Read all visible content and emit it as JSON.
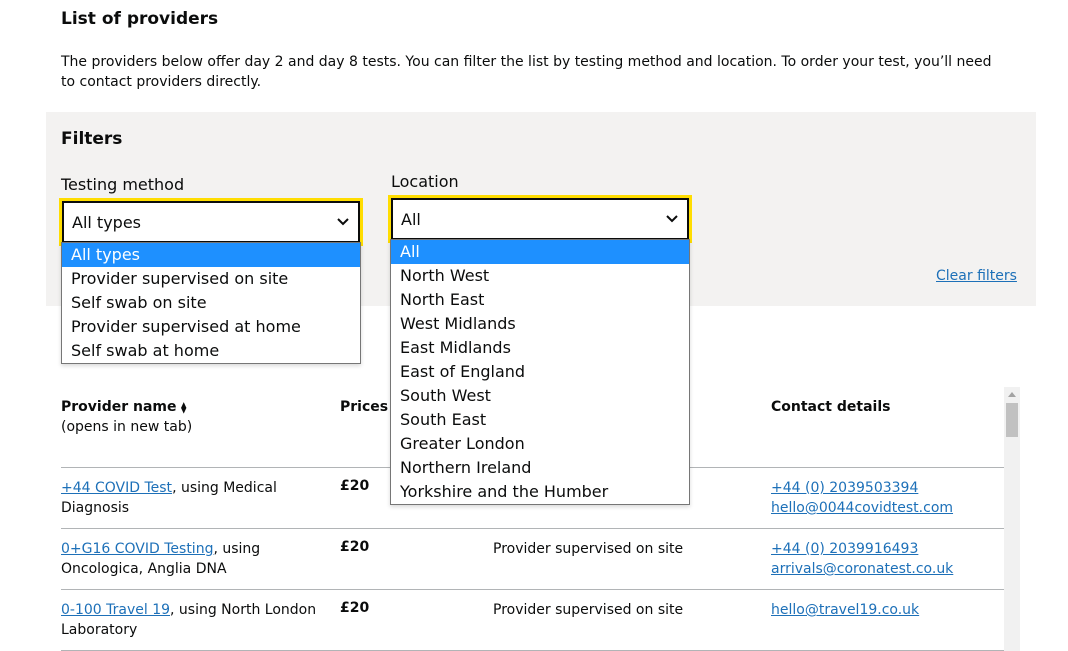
{
  "page": {
    "title": "List of providers",
    "intro": "The providers below offer day 2 and day 8 tests. You can filter the list by testing method and location. To order your test, you’ll need to contact providers directly."
  },
  "filters": {
    "title": "Filters",
    "testing_method": {
      "label": "Testing method",
      "selected": "All types",
      "options": [
        "All types",
        "Provider supervised on site",
        "Self swab on site",
        "Provider supervised at home",
        "Self swab at home"
      ]
    },
    "location": {
      "label": "Location",
      "selected": "All",
      "options": [
        "All",
        "North West",
        "North East",
        "West Midlands",
        "East Midlands",
        "East of England",
        "South West",
        "South East",
        "Greater London",
        "Northern Ireland",
        "Yorkshire and the Humber"
      ]
    },
    "clear_label": "Clear filters"
  },
  "table": {
    "headers": {
      "provider": "Provider name",
      "provider_sort_glyph": "⧫",
      "provider_note": "(opens in new tab)",
      "prices": "Prices",
      "contact": "Contact details"
    },
    "rows": [
      {
        "name": "+44 COVID Test",
        "lab_prefix": ", using Medical",
        "lab_rest": "Diagnosis",
        "price": "£20",
        "method": "",
        "phone": "+44 (0) 2039503394",
        "email": "hello@0044covidtest.com"
      },
      {
        "name": "0+G16 COVID Testing",
        "lab_prefix": ", using",
        "lab_rest": "Oncologica, Anglia DNA",
        "price": "£20",
        "method": "Provider supervised on site",
        "phone": "+44 (0) 2039916493",
        "email": "arrivals@coronatest.co.uk"
      },
      {
        "name": "0-100 Travel 19",
        "lab_prefix": ", using North London",
        "lab_rest": "Laboratory",
        "price": "£20",
        "method": "Provider supervised on site",
        "phone": "hello@travel19.co.uk",
        "email": ""
      }
    ]
  },
  "colors": {
    "link": "#1d70b8",
    "focus": "#ffdd00",
    "panel": "#f3f2f1",
    "selected_option": "#1e90ff"
  },
  "icons": {
    "select_chevron": "chevron-down-icon",
    "scroll_up": "arrow-up-icon"
  }
}
